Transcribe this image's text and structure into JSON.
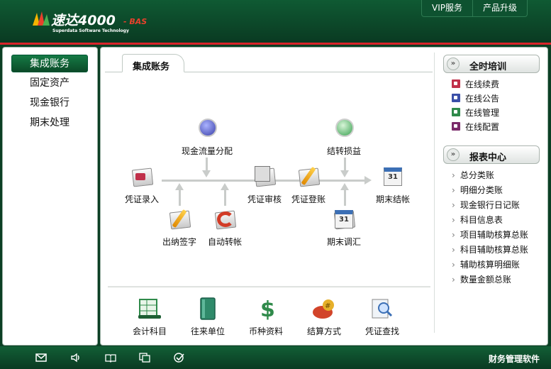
{
  "header": {
    "logo_text": "速达4000",
    "logo_suffix": "- BAS",
    "logo_subtitle": "Superdata Software Technology",
    "links": [
      "VIP服务",
      "产品升级"
    ]
  },
  "sidebar": {
    "items": [
      {
        "label": "集成账务",
        "active": true
      },
      {
        "label": "固定资产",
        "active": false
      },
      {
        "label": "现金银行",
        "active": false
      },
      {
        "label": "期末处理",
        "active": false
      }
    ]
  },
  "main": {
    "tab": "集成账务",
    "flow": {
      "voucher_entry": "凭证录入",
      "cash_flow": "现金流量分配",
      "cashier_sign": "出纳签字",
      "auto_transfer": "自动转帐",
      "voucher_review": "凭证审核",
      "voucher_post": "凭证登账",
      "carry_forward": "结转损益",
      "period_adjust": "期末调汇",
      "period_close": "期末结帐"
    },
    "tools": [
      "会计科目",
      "往来单位",
      "币种资料",
      "结算方式",
      "凭证查找"
    ]
  },
  "training": {
    "title": "全时培训",
    "items": [
      {
        "label": "在线续费",
        "color": "#c0304a"
      },
      {
        "label": "在线公告",
        "color": "#3a4fa8"
      },
      {
        "label": "在线管理",
        "color": "#2f8a4a"
      },
      {
        "label": "在线配置",
        "color": "#7a2a6a"
      }
    ]
  },
  "reports": {
    "title": "报表中心",
    "items": [
      "总分类账",
      "明细分类账",
      "现金银行日记账",
      "科目信息表",
      "项目辅助核算总账",
      "科目辅助核算总账",
      "辅助核算明细账",
      "数量金额总账"
    ]
  },
  "footer": {
    "icons": [
      "mail-icon",
      "speaker-icon",
      "book-icon",
      "window-icon",
      "check-icon"
    ],
    "text": "财务管理软件"
  }
}
